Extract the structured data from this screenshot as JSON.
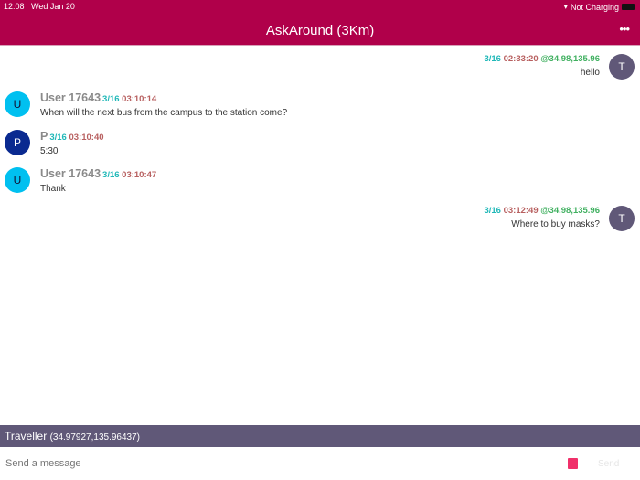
{
  "status": {
    "time": "12:08",
    "date": "Wed Jan 20",
    "charging": "Not Charging"
  },
  "header": {
    "title": "AskAround (3Km)",
    "menu": "•••"
  },
  "messages": [
    {
      "side": "right",
      "avatar": "T",
      "date": "3/16",
      "time": "02:33:20",
      "location": "@34.98,135.96",
      "text": "hello"
    },
    {
      "side": "left",
      "avatar": "U",
      "name": "User 17643",
      "date": "3/16",
      "time": "03:10:14",
      "text": "When will the next bus from the campus to the station come?"
    },
    {
      "side": "left",
      "avatar": "P",
      "name": "P",
      "date": "3/16",
      "time": "03:10:40",
      "text": "5:30"
    },
    {
      "side": "left",
      "avatar": "U",
      "name": "User 17643",
      "date": "3/16",
      "time": "03:10:47",
      "text": "Thank"
    },
    {
      "side": "right",
      "avatar": "T",
      "date": "3/16",
      "time": "03:12:49",
      "location": "@34.98,135.96",
      "text": "Where to buy masks?"
    }
  ],
  "footer": {
    "name": "Traveller",
    "coords": "(34.97927,135.96437)"
  },
  "composer": {
    "placeholder": "Send a message",
    "send": "Send"
  },
  "colors": {
    "header": "#b0004a",
    "footer": "#605878",
    "avatar_T": "#605878",
    "avatar_U": "#00c0f0",
    "avatar_P": "#0a2a90"
  }
}
